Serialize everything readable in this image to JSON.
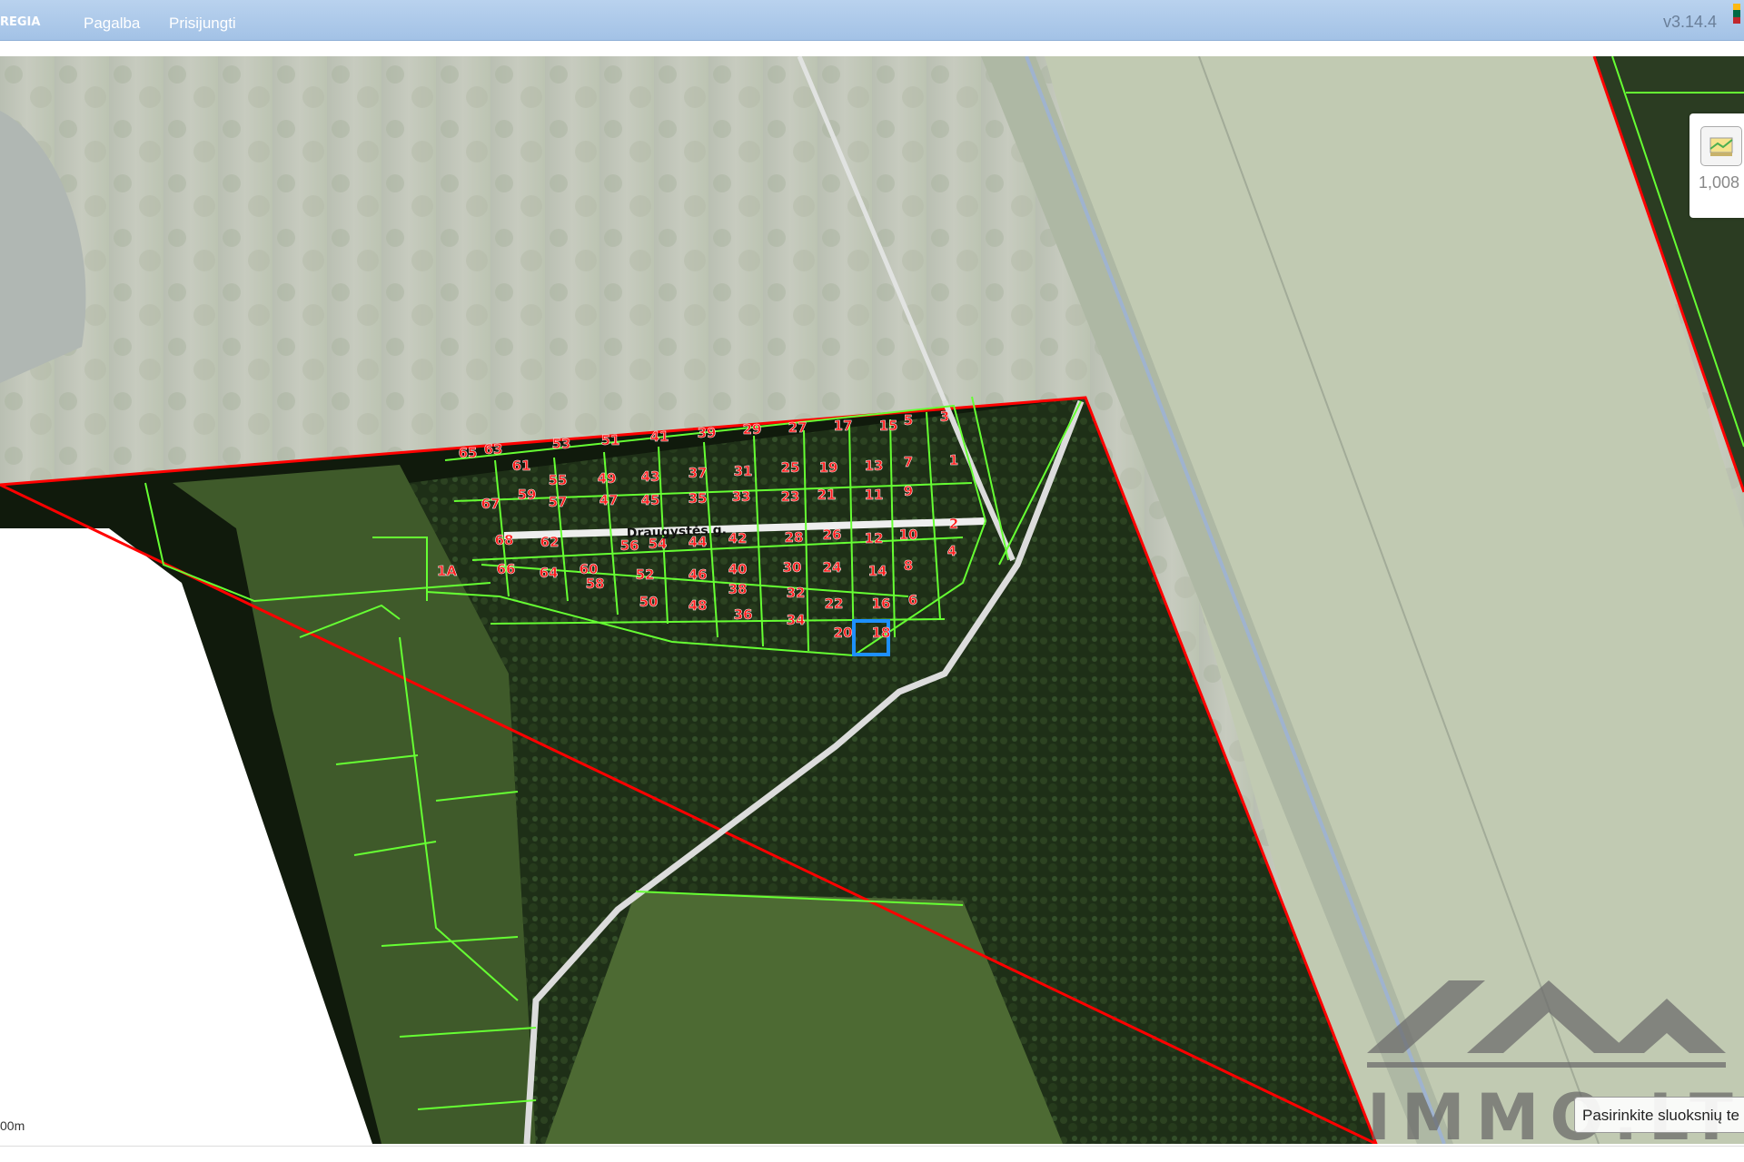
{
  "header": {
    "brand": "REGIA",
    "nav": [
      {
        "label": "Pagalba"
      },
      {
        "label": "Prisijungti"
      }
    ],
    "version": "v3.14.4"
  },
  "flag_colors": [
    "#fdb913",
    "#006a44",
    "#c1272d"
  ],
  "map": {
    "street_label": "Draugystės g.",
    "selected_parcel": "14",
    "parcels": [
      {
        "label": "65"
      },
      {
        "label": "63"
      },
      {
        "label": "53"
      },
      {
        "label": "51"
      },
      {
        "label": "41"
      },
      {
        "label": "39"
      },
      {
        "label": "29"
      },
      {
        "label": "27"
      },
      {
        "label": "17"
      },
      {
        "label": "15"
      },
      {
        "label": "5"
      },
      {
        "label": "3"
      },
      {
        "label": "61"
      },
      {
        "label": "55"
      },
      {
        "label": "49"
      },
      {
        "label": "43"
      },
      {
        "label": "37"
      },
      {
        "label": "31"
      },
      {
        "label": "25"
      },
      {
        "label": "19"
      },
      {
        "label": "13"
      },
      {
        "label": "7"
      },
      {
        "label": "1"
      },
      {
        "label": "67"
      },
      {
        "label": "59"
      },
      {
        "label": "57"
      },
      {
        "label": "47"
      },
      {
        "label": "45"
      },
      {
        "label": "35"
      },
      {
        "label": "33"
      },
      {
        "label": "23"
      },
      {
        "label": "21"
      },
      {
        "label": "11"
      },
      {
        "label": "9"
      },
      {
        "label": "68"
      },
      {
        "label": "62"
      },
      {
        "label": "56"
      },
      {
        "label": "54"
      },
      {
        "label": "44"
      },
      {
        "label": "42"
      },
      {
        "label": "28"
      },
      {
        "label": "26"
      },
      {
        "label": "12"
      },
      {
        "label": "10"
      },
      {
        "label": "2"
      },
      {
        "label": "1A"
      },
      {
        "label": "66"
      },
      {
        "label": "64"
      },
      {
        "label": "60"
      },
      {
        "label": "58"
      },
      {
        "label": "52"
      },
      {
        "label": "46"
      },
      {
        "label": "40"
      },
      {
        "label": "30"
      },
      {
        "label": "24"
      },
      {
        "label": "14"
      },
      {
        "label": "8"
      },
      {
        "label": "4"
      },
      {
        "label": "50"
      },
      {
        "label": "48"
      },
      {
        "label": "38"
      },
      {
        "label": "36"
      },
      {
        "label": "32"
      },
      {
        "label": "34"
      },
      {
        "label": "22"
      },
      {
        "label": "16"
      },
      {
        "label": "6"
      },
      {
        "label": "20"
      },
      {
        "label": "18"
      }
    ]
  },
  "scale_label": "00m",
  "zoom_value": "1,008",
  "zoom_icon": "layers-map-icon",
  "layer_select_text": "Pasirinkite sluoksnių te",
  "watermark_text": "IMMO.LT",
  "colors": {
    "parcel_line": "#66ff33",
    "boundary": "#ff0000",
    "parcel_label": "#ff1a1a",
    "selected": "#1e90ff",
    "road": "#eeeeee"
  }
}
